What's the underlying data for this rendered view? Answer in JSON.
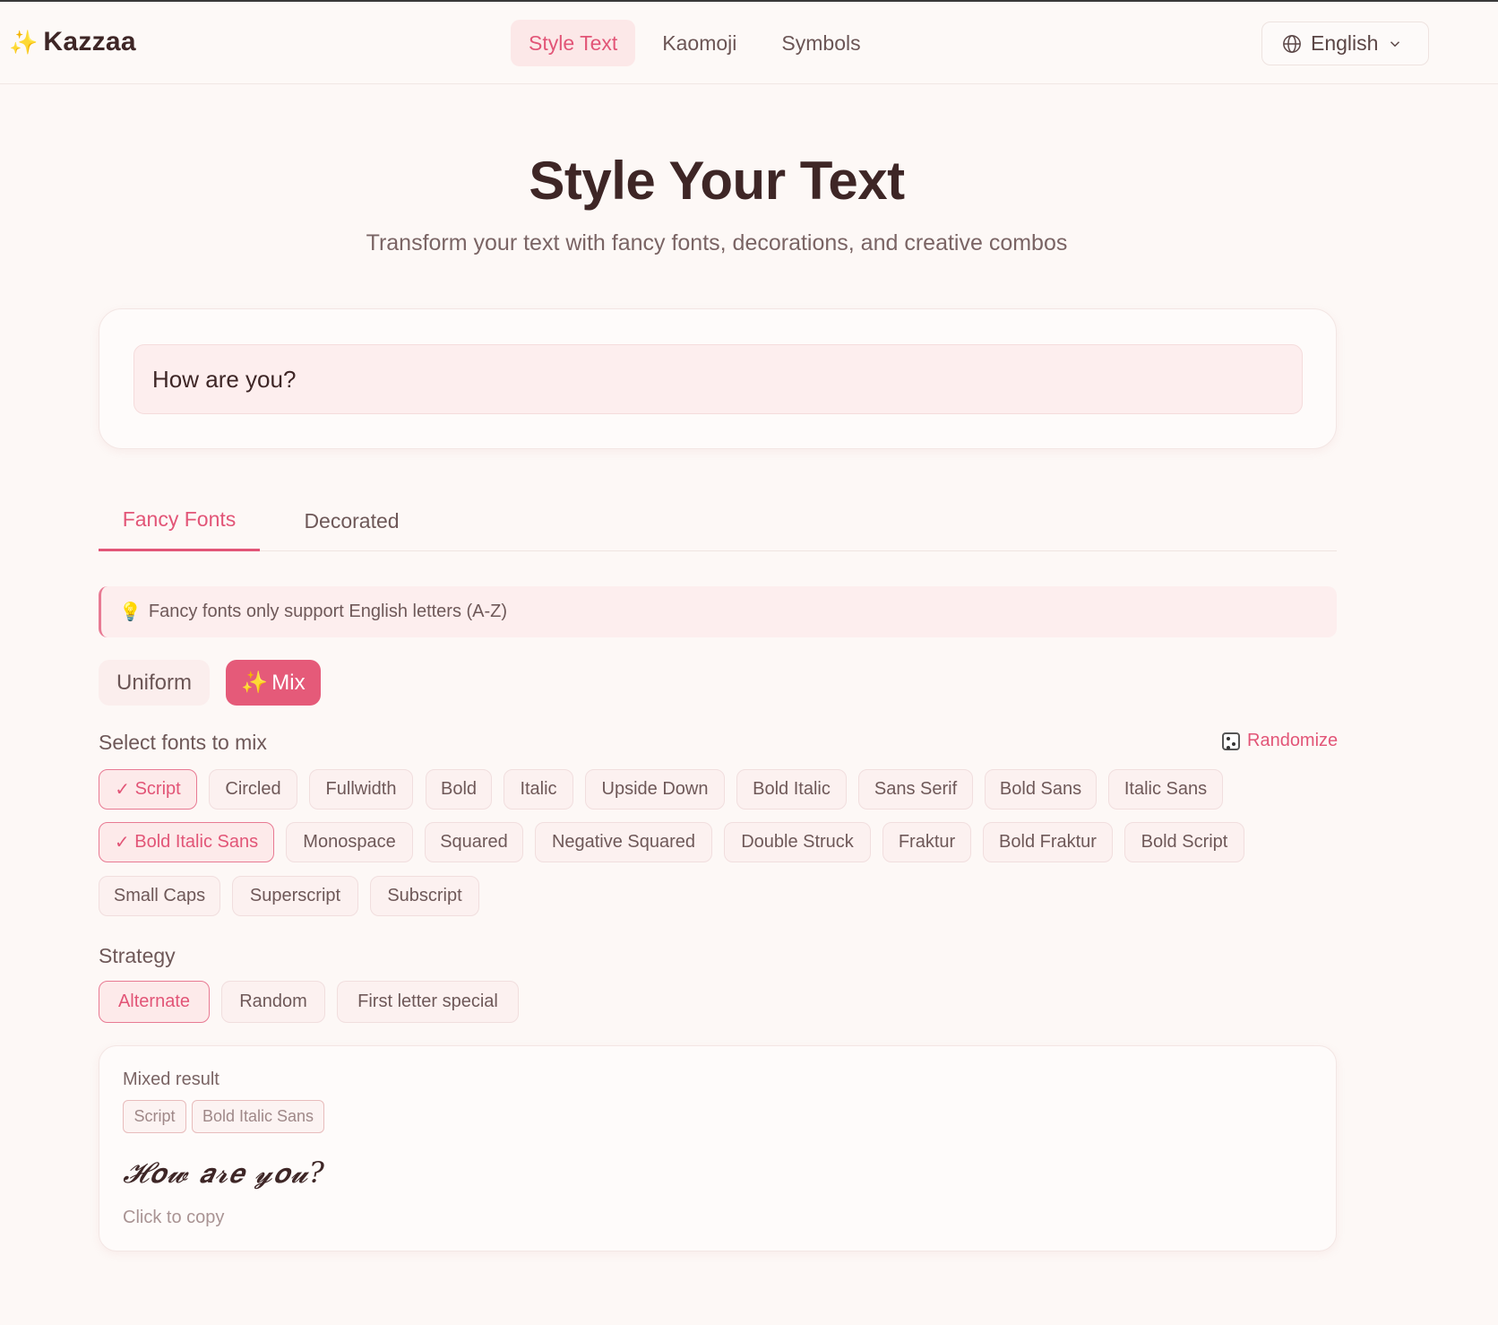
{
  "brand": {
    "icon": "sparkles-icon",
    "name": "Kazzaa"
  },
  "nav": {
    "items": [
      {
        "label": "Style Text",
        "active": true
      },
      {
        "label": "Kaomoji",
        "active": false
      },
      {
        "label": "Symbols",
        "active": false
      }
    ],
    "language": {
      "icon": "globe-icon",
      "label": "English"
    }
  },
  "hero": {
    "title": "Style Your Text",
    "subtitle": "Transform your text with fancy fonts, decorations, and creative combos"
  },
  "input": {
    "value": "How are you?"
  },
  "tabs": [
    {
      "label": "Fancy Fonts",
      "active": true
    },
    {
      "label": "Decorated",
      "active": false
    }
  ],
  "tip": {
    "icon": "lightbulb-icon",
    "text": "Fancy fonts only support English letters (A-Z)"
  },
  "mode": {
    "uniform": "Uniform",
    "mix": "Mix",
    "selected": "Mix"
  },
  "fonts_section": {
    "label": "Select fonts to mix",
    "randomize": "Randomize",
    "fonts": [
      {
        "label": "Script",
        "selected": true
      },
      {
        "label": "Circled",
        "selected": false
      },
      {
        "label": "Fullwidth",
        "selected": false
      },
      {
        "label": "Bold",
        "selected": false
      },
      {
        "label": "Italic",
        "selected": false
      },
      {
        "label": "Upside Down",
        "selected": false
      },
      {
        "label": "Bold Italic",
        "selected": false
      },
      {
        "label": "Sans Serif",
        "selected": false
      },
      {
        "label": "Bold Sans",
        "selected": false
      },
      {
        "label": "Italic Sans",
        "selected": false
      },
      {
        "label": "Bold Italic Sans",
        "selected": true
      },
      {
        "label": "Monospace",
        "selected": false
      },
      {
        "label": "Squared",
        "selected": false
      },
      {
        "label": "Negative Squared",
        "selected": false
      },
      {
        "label": "Double Struck",
        "selected": false
      },
      {
        "label": "Fraktur",
        "selected": false
      },
      {
        "label": "Bold Fraktur",
        "selected": false
      },
      {
        "label": "Bold Script",
        "selected": false
      },
      {
        "label": "Small Caps",
        "selected": false
      },
      {
        "label": "Superscript",
        "selected": false
      },
      {
        "label": "Subscript",
        "selected": false
      }
    ]
  },
  "strategy": {
    "label": "Strategy",
    "options": [
      {
        "label": "Alternate",
        "selected": true
      },
      {
        "label": "Random",
        "selected": false
      },
      {
        "label": "First letter special",
        "selected": false
      }
    ]
  },
  "result": {
    "label": "Mixed result",
    "tags": [
      "Script",
      "Bold Italic Sans"
    ],
    "text": "𝓗𝙤𝔀 𝙖𝓻𝙚 𝔂𝙤𝓾?",
    "hint": "Click to copy"
  },
  "colors": {
    "accent": "#e25577",
    "background": "#fdf8f6",
    "text": "#3e2626"
  }
}
